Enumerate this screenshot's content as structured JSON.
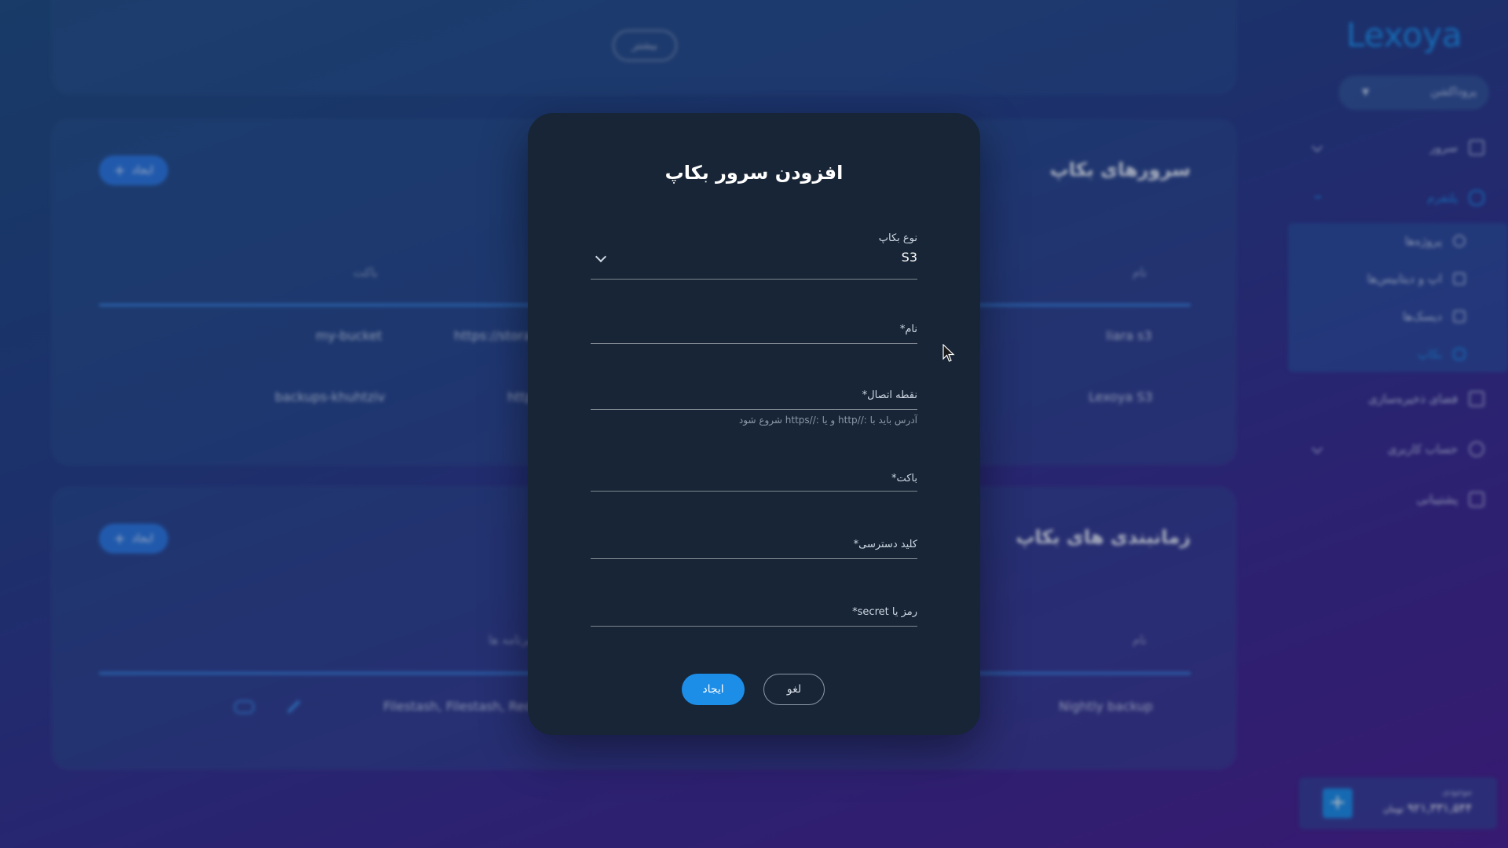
{
  "background": {
    "top_card": {
      "more_button": "بیشتر"
    },
    "backup_servers": {
      "title": "سرورهای بکاپ",
      "create_button": "ایجاد",
      "columns": {
        "name": "نام",
        "bucket": "باکت"
      },
      "rows": [
        {
          "name": "liara s3",
          "endpoint": "https://stora",
          "bucket": "my-bucket"
        },
        {
          "name": "Lexoya S3",
          "endpoint": "http",
          "bucket": "backups-khuhtziv"
        }
      ]
    },
    "schedules": {
      "title": "زمانبندی های بکاپ",
      "create_button": "ایجاد",
      "columns": {
        "name": "نام",
        "programs": "برنامه ها"
      },
      "rows": [
        {
          "name": "Nightly backup",
          "programs": "Filestash, Filestash, Redi"
        }
      ]
    },
    "sidebar": {
      "logo": "Lexoya",
      "project_select": "پروداکشن",
      "items": [
        {
          "label": "سرور"
        },
        {
          "label": "پلتفرم"
        },
        {
          "label": "پروژه‌ها"
        },
        {
          "label": "اپ و دیتابیس‌ها"
        },
        {
          "label": "دیسک‌ها"
        },
        {
          "label": "بکاپ"
        },
        {
          "label": "فضای ذخیره‌سازی"
        },
        {
          "label": "حساب کاربری"
        },
        {
          "label": "پشتیبانی"
        }
      ],
      "balance": {
        "label": "موجودی",
        "amount": "۹۲۱,۳۳۱,۵۴۴",
        "unit": "تومان"
      }
    }
  },
  "modal": {
    "title": "افزودن سرور بکاپ",
    "backup_type": {
      "label": "نوع بکاپ",
      "value": "S3"
    },
    "name": {
      "label": "نام*"
    },
    "endpoint": {
      "label": "نقطه اتصال*",
      "hint": "آدرس باید با ://http و یا ://https شروع شود"
    },
    "bucket": {
      "label": "باکت*"
    },
    "access_key": {
      "label": "کلید دسترسی*"
    },
    "secret": {
      "label": "رمز یا secret*"
    },
    "create_button": "ایجاد",
    "cancel_button": "لغو"
  }
}
